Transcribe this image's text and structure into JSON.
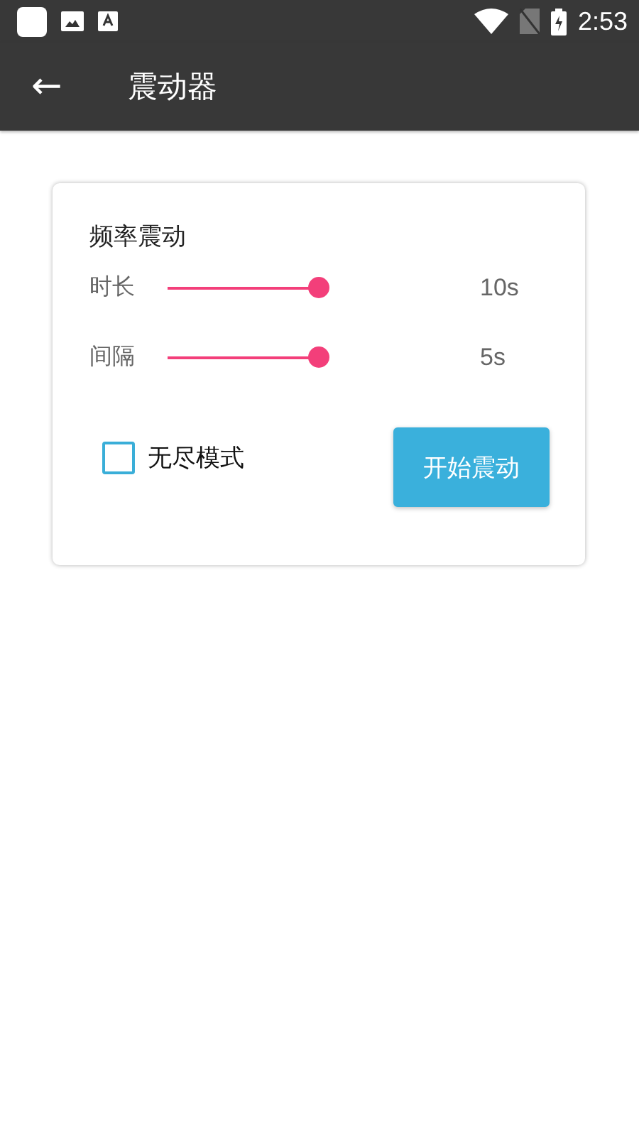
{
  "status_bar": {
    "time": "2:53"
  },
  "app_bar": {
    "back_icon": "←",
    "title": "震动器"
  },
  "card": {
    "title": "频率震动",
    "sliders": [
      {
        "label": "时长",
        "level": 1.0,
        "reading": "10s"
      },
      {
        "label": "间隔",
        "level": 1.0,
        "reading": "5s"
      }
    ],
    "endless": {
      "label": "无尽模式",
      "checked": false
    },
    "start_button": "开始震动"
  }
}
